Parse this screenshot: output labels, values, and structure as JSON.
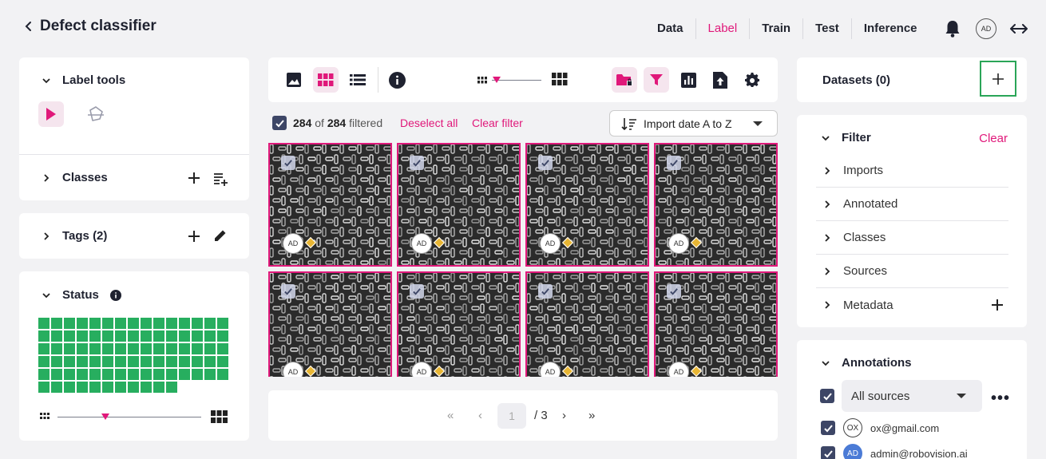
{
  "header": {
    "title": "Defect classifier",
    "nav": [
      {
        "label": "Data",
        "active": false
      },
      {
        "label": "Label",
        "active": true
      },
      {
        "label": "Train",
        "active": false
      },
      {
        "label": "Test",
        "active": false
      },
      {
        "label": "Inference",
        "active": false
      }
    ],
    "avatar_initials": "AD",
    "icons": [
      "chevron-left-icon",
      "bell-icon",
      "expand-horizontal-icon"
    ]
  },
  "label_tools": {
    "title": "Label tools",
    "tools": [
      "pointer-icon",
      "polygon-icon"
    ]
  },
  "classes": {
    "title": "Classes"
  },
  "tags": {
    "title": "Tags (2)"
  },
  "status": {
    "title": "Status",
    "filled_cells": 86,
    "cell_color": "#27ae5f"
  },
  "toolbar": {
    "icons": [
      "image-view-icon",
      "grid-view-icon",
      "list-view-icon",
      "info-icon",
      "small-grid-icon",
      "large-grid-icon",
      "folder-lock-icon",
      "filter-icon",
      "chart-icon",
      "upload-icon",
      "settings-icon"
    ],
    "zoom_level": 0.1
  },
  "selection": {
    "selected": "284",
    "of": "of",
    "total": "284",
    "suffix": "filtered",
    "deselect_all": "Deselect all",
    "clear_filter": "Clear filter"
  },
  "sort": {
    "label": "Import date A to Z"
  },
  "tiles": [
    {
      "initials": "AD"
    },
    {
      "initials": "AD"
    },
    {
      "initials": "AD"
    },
    {
      "initials": "AD"
    },
    {
      "initials": "AD"
    },
    {
      "initials": "AD"
    },
    {
      "initials": "AD"
    },
    {
      "initials": "AD"
    }
  ],
  "pagination": {
    "current": "1",
    "total": "/ 3"
  },
  "datasets": {
    "title": "Datasets (0)"
  },
  "filter": {
    "title": "Filter",
    "clear": "Clear",
    "items": [
      "Imports",
      "Annotated",
      "Classes",
      "Sources",
      "Metadata"
    ]
  },
  "annotations": {
    "title": "Annotations",
    "source": "All sources",
    "users": [
      {
        "initials": "OX",
        "email": "ox@gmail.com"
      },
      {
        "initials": "AD",
        "email": "admin@robovision.ai"
      }
    ]
  },
  "colors": {
    "accent": "#e0187a",
    "status": "#27ae5f",
    "checkbox": "#3d4666"
  }
}
